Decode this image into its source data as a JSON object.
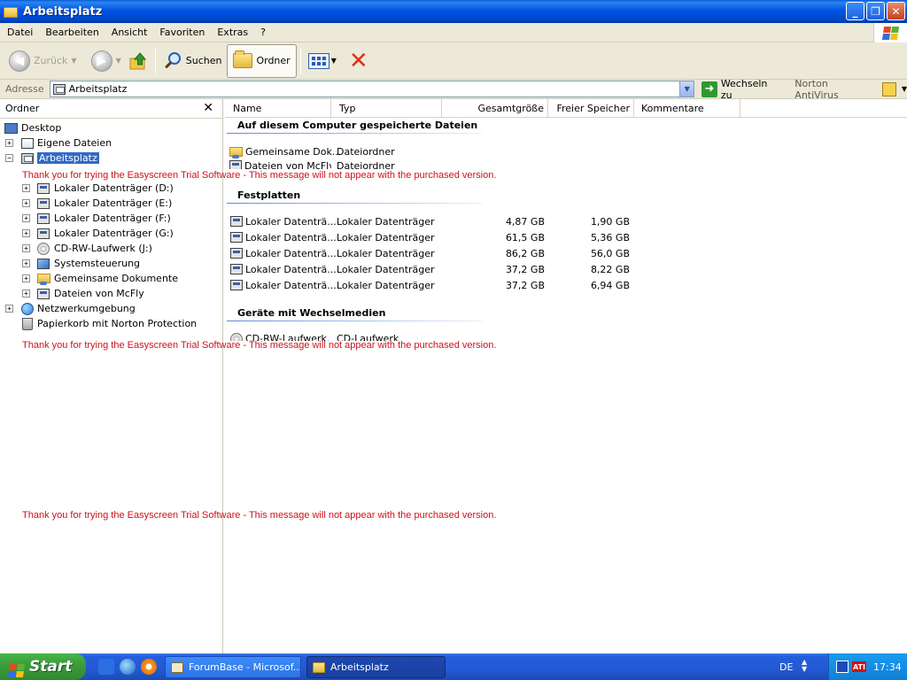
{
  "window": {
    "title": "Arbeitsplatz"
  },
  "menu": [
    "Datei",
    "Bearbeiten",
    "Ansicht",
    "Favoriten",
    "Extras",
    "?"
  ],
  "toolbar": {
    "back_label": "Zurück",
    "search_label": "Suchen",
    "folders_label": "Ordner"
  },
  "address": {
    "label": "Adresse",
    "value": "Arbeitsplatz",
    "go_label": "Wechseln zu",
    "norton_label": "Norton AntiVirus"
  },
  "folder_pane": {
    "title": "Ordner",
    "items": [
      {
        "label": "Desktop",
        "icon": "desktop-icon"
      },
      {
        "label": "Eigene Dateien",
        "icon": "my-documents-icon"
      },
      {
        "label": "Arbeitsplatz",
        "icon": "my-computer-icon",
        "selected": true
      },
      {
        "label": "Lokaler Datenträger (D:)",
        "icon": "drive-icon"
      },
      {
        "label": "Lokaler Datenträger (E:)",
        "icon": "drive-icon"
      },
      {
        "label": "Lokaler Datenträger (F:)",
        "icon": "drive-icon"
      },
      {
        "label": "Lokaler Datenträger (G:)",
        "icon": "drive-icon"
      },
      {
        "label": "CD-RW-Laufwerk (J:)",
        "icon": "cd-drive-icon"
      },
      {
        "label": "Systemsteuerung",
        "icon": "control-panel-icon"
      },
      {
        "label": "Gemeinsame Dokumente",
        "icon": "shared-folder-icon"
      },
      {
        "label": "Dateien von McFly",
        "icon": "folder-icon"
      },
      {
        "label": "Netzwerkumgebung",
        "icon": "network-icon"
      },
      {
        "label": "Papierkorb mit Norton Protection",
        "icon": "recycle-bin-icon"
      }
    ]
  },
  "columns": [
    "Name",
    "Typ",
    "Gesamtgröße",
    "Freier Speicher",
    "Kommentare"
  ],
  "groups": {
    "stored": {
      "title": "Auf diesem Computer gespeicherte Dateien",
      "rows": [
        {
          "name": "Gemeinsame Dok...",
          "type": "Dateiordner"
        },
        {
          "name": "Dateien von McFly",
          "type": "Dateiordner"
        }
      ]
    },
    "disks": {
      "title": "Festplatten",
      "rows": [
        {
          "name": "Lokaler Datenträ...",
          "type": "Lokaler Datenträger",
          "total": "4,87 GB",
          "free": "1,90 GB"
        },
        {
          "name": "Lokaler Datenträ...",
          "type": "Lokaler Datenträger",
          "total": "61,5 GB",
          "free": "5,36 GB"
        },
        {
          "name": "Lokaler Datenträ...",
          "type": "Lokaler Datenträger",
          "total": "86,2 GB",
          "free": "56,0 GB"
        },
        {
          "name": "Lokaler Datenträ...",
          "type": "Lokaler Datenträger",
          "total": "37,2 GB",
          "free": "8,22 GB"
        },
        {
          "name": "Lokaler Datenträ...",
          "type": "Lokaler Datenträger",
          "total": "37,2 GB",
          "free": "6,94 GB"
        }
      ]
    },
    "removable": {
      "title": "Geräte mit Wechselmedien",
      "rows": [
        {
          "name": "CD-RW-Laufwerk...",
          "type": "CD-Laufwerk"
        }
      ]
    }
  },
  "trial_message": "Thank you for trying the Easyscreen Trial Software - This message will not appear with the purchased version.",
  "taskbar": {
    "start_label": "Start",
    "tasks": [
      "ForumBase - Microsof...",
      "Arbeitsplatz"
    ],
    "language": "DE",
    "clock": "17:34"
  },
  "colors": {
    "titlebar": "#0054e3",
    "selection": "#316ac5",
    "trial_text": "#d0101a",
    "start_green": "#3d9d3d"
  }
}
